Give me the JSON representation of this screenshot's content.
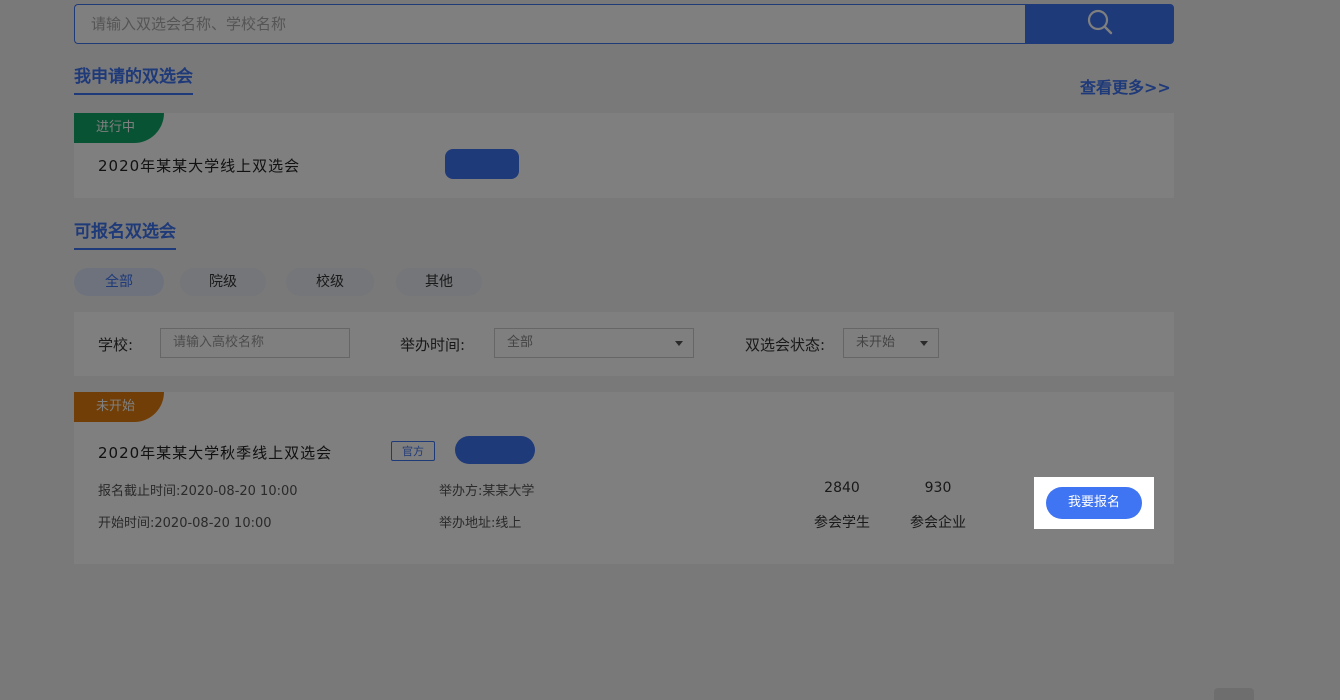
{
  "search": {
    "placeholder": "请输入双选会名称、学校名称"
  },
  "applied": {
    "title": "我申请的双选会",
    "more": "查看更多>>"
  },
  "applied_card": {
    "status": "进行中",
    "status_color": "#13a66a",
    "title": "2020年某某大学线上双选会"
  },
  "available": {
    "title": "可报名双选会"
  },
  "tabs": [
    {
      "label": "全部"
    },
    {
      "label": "院级"
    },
    {
      "label": "校级"
    },
    {
      "label": "其他"
    }
  ],
  "filters": {
    "school_label": "学校:",
    "school_placeholder": "请输入高校名称",
    "time_label": "举办时间:",
    "time_value": "全部",
    "status_label": "双选会状态:",
    "status_value": "未开始"
  },
  "fair_card": {
    "status": "未开始",
    "status_color": "#e07c0c",
    "title": "2020年某某大学秋季线上双选会",
    "official": "官方",
    "deadline": "报名截止时间:2020-08-20 10:00",
    "start": "开始时间:2020-08-20 10:00",
    "organizer": "举办方:某某大学",
    "address": "举办地址:线上",
    "students_count": "2840",
    "students_label": "参会学生",
    "companies_count": "930",
    "companies_label": "参会企业",
    "signup": "我要报名"
  },
  "colors": {
    "accent": "#3f74f2"
  }
}
